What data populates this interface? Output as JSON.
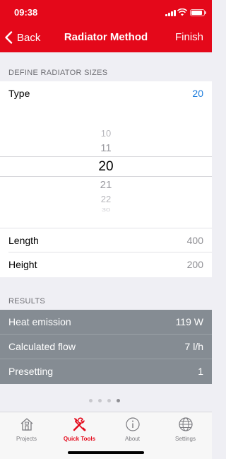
{
  "status": {
    "time": "09:38"
  },
  "nav": {
    "back_label": "Back",
    "title": "Radiator Method",
    "finish_label": "Finish"
  },
  "define": {
    "header": "DEFINE RADIATOR SIZES",
    "type_label": "Type",
    "type_value": "20",
    "picker_items": [
      "10",
      "11",
      "20",
      "21",
      "22",
      "30"
    ],
    "length_label": "Length",
    "length_value": "400",
    "height_label": "Height",
    "height_value": "200"
  },
  "results": {
    "header": "RESULTS",
    "rows": [
      {
        "label": "Heat emission",
        "value": "119 W"
      },
      {
        "label": "Calculated flow",
        "value": "7 l/h"
      },
      {
        "label": "Presetting",
        "value": "1"
      }
    ]
  },
  "pager": {
    "count": 4,
    "active_index": 3
  },
  "tabs": [
    {
      "label": "Projects",
      "icon": "house-icon"
    },
    {
      "label": "Quick Tools",
      "icon": "tools-icon"
    },
    {
      "label": "About",
      "icon": "info-icon"
    },
    {
      "label": "Settings",
      "icon": "globe-icon"
    }
  ],
  "colors": {
    "brand_red": "#e4081a",
    "link_blue": "#1a7bdc",
    "results_bg": "#858c93"
  }
}
